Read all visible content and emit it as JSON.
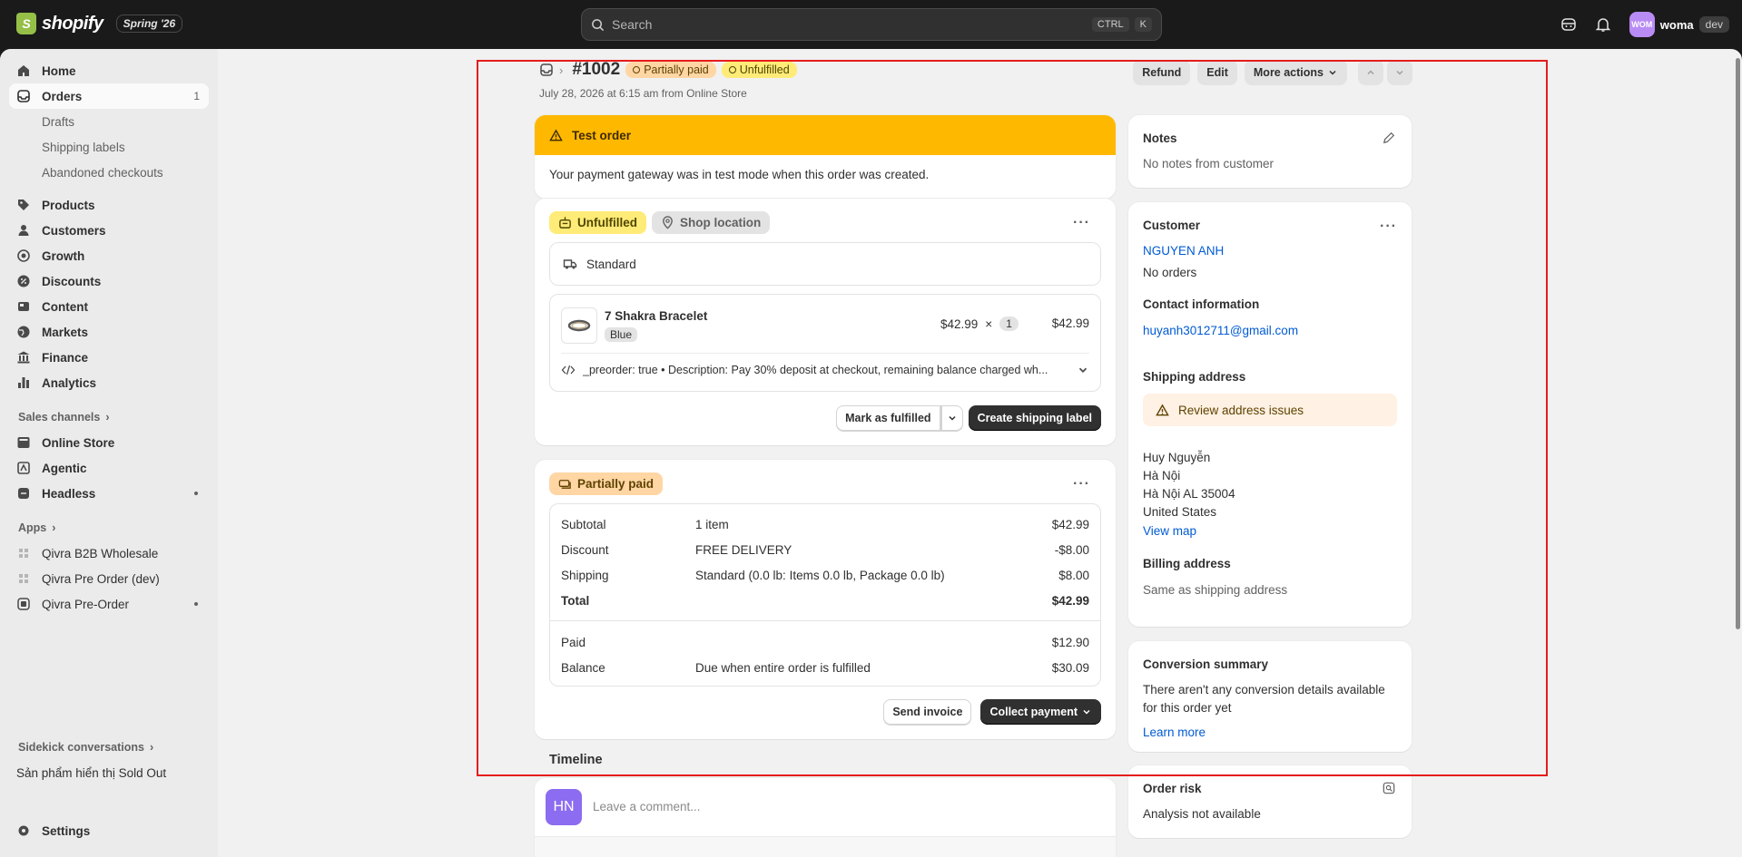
{
  "topbar": {
    "brand": "shopify",
    "edition": "Spring '26",
    "search_placeholder": "Search",
    "kbd_ctrl": "CTRL",
    "kbd_k": "K",
    "store_initials": "WOM",
    "store_name": "woma",
    "store_env": "dev"
  },
  "sidebar": {
    "home": "Home",
    "orders": "Orders",
    "orders_count": "1",
    "drafts": "Drafts",
    "shipping_labels": "Shipping labels",
    "abandoned": "Abandoned checkouts",
    "products": "Products",
    "customers": "Customers",
    "growth": "Growth",
    "discounts": "Discounts",
    "content": "Content",
    "markets": "Markets",
    "finance": "Finance",
    "analytics": "Analytics",
    "sales_channels": "Sales channels",
    "online_store": "Online Store",
    "agentic": "Agentic",
    "headless": "Headless",
    "apps": "Apps",
    "app1": "Qivra B2B Wholesale",
    "app2": "Qivra Pre Order (dev)",
    "app3": "Qivra Pre-Order",
    "sidekick": "Sidekick conversations",
    "sidekick_item": "Sản phẩm hiển thị Sold Out",
    "settings": "Settings"
  },
  "header": {
    "order_number": "#1002",
    "payment_badge": "Partially paid",
    "fulfillment_badge": "Unfulfilled",
    "date_line": "July 28, 2026 at 6:15 am from Online Store",
    "refund": "Refund",
    "edit": "Edit",
    "more_actions": "More actions"
  },
  "test_order": {
    "title": "Test order",
    "message": "Your payment gateway was in test mode when this order was created."
  },
  "fulfillment": {
    "status": "Unfulfilled",
    "location": "Shop location",
    "method": "Standard",
    "item_name": "7 Shakra Bracelet",
    "variant": "Blue",
    "unit_price": "$42.99",
    "times": "×",
    "quantity": "1",
    "line_total": "$42.99",
    "properties": "_preorder: true • Description: Pay 30% deposit at checkout, remaining balance charged wh...",
    "mark_fulfilled": "Mark as fulfilled",
    "create_label": "Create shipping label"
  },
  "payment": {
    "status": "Partially paid",
    "rows": [
      {
        "label": "Subtotal",
        "desc": "1 item",
        "amount": "$42.99"
      },
      {
        "label": "Discount",
        "desc": "FREE DELIVERY",
        "amount": "-$8.00"
      },
      {
        "label": "Shipping",
        "desc": "Standard (0.0 lb: Items 0.0 lb, Package 0.0 lb)",
        "amount": "$8.00"
      },
      {
        "label": "Total",
        "desc": "",
        "amount": "$42.99"
      },
      {
        "label": "Paid",
        "desc": "",
        "amount": "$12.90"
      },
      {
        "label": "Balance",
        "desc": "Due when entire order is fulfilled",
        "amount": "$30.09"
      }
    ],
    "send_invoice": "Send invoice",
    "collect_payment": "Collect payment"
  },
  "timeline": {
    "title": "Timeline",
    "avatar": "HN",
    "placeholder": "Leave a comment..."
  },
  "notes": {
    "title": "Notes",
    "text": "No notes from customer"
  },
  "customer": {
    "title": "Customer",
    "name": "NGUYEN ANH",
    "orders": "No orders",
    "contact_title": "Contact information",
    "email": "huyanh3012711@gmail.com",
    "shipping_title": "Shipping address",
    "review_issues": "Review address issues",
    "addr1": "Huy Nguyễn",
    "addr2": "Hà Nội",
    "addr3": "Hà Nội AL 35004",
    "addr4": "United States",
    "view_map": "View map",
    "billing_title": "Billing address",
    "billing_text": "Same as shipping address"
  },
  "conversion": {
    "title": "Conversion summary",
    "text1": "There aren't any conversion details available",
    "text2": "for this order yet",
    "link": "Learn more"
  },
  "risk": {
    "title": "Order risk",
    "text": "Analysis not available"
  },
  "colors": {
    "accent_link": "#005bd3",
    "warning": "#ffb800",
    "highlight_border": "#e51c1c"
  }
}
